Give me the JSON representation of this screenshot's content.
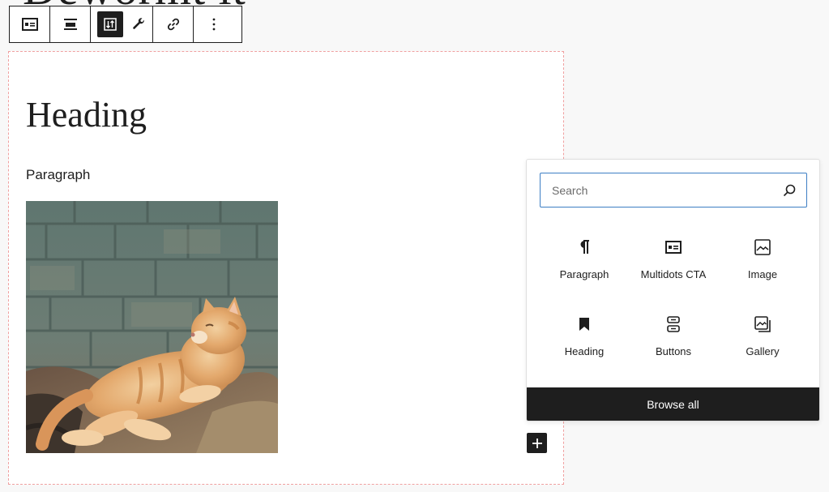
{
  "background_title": "Dewormt it",
  "toolbar": {
    "buttons": [
      {
        "name": "block-type-icon"
      },
      {
        "name": "align-icon"
      },
      {
        "name": "move-icon"
      },
      {
        "name": "wrench-icon"
      },
      {
        "name": "link-icon"
      },
      {
        "name": "more-options-icon"
      }
    ]
  },
  "canvas": {
    "heading": "Heading",
    "paragraph": "Paragraph",
    "image_alt": "Orange tabby cat lying on rocks in front of a stone wall"
  },
  "inserter": {
    "search": {
      "placeholder": "Search",
      "value": ""
    },
    "blocks": [
      {
        "label": "Paragraph",
        "icon": "paragraph-icon"
      },
      {
        "label": "Multidots CTA",
        "icon": "cta-icon"
      },
      {
        "label": "Image",
        "icon": "image-icon"
      },
      {
        "label": "Heading",
        "icon": "bookmark-icon"
      },
      {
        "label": "Buttons",
        "icon": "buttons-icon"
      },
      {
        "label": "Gallery",
        "icon": "gallery-icon"
      }
    ],
    "browse_all": "Browse all"
  },
  "colors": {
    "dark": "#1e1e1e",
    "search_border": "#3d7ec4",
    "canvas_outline": "#f0a0a0"
  }
}
